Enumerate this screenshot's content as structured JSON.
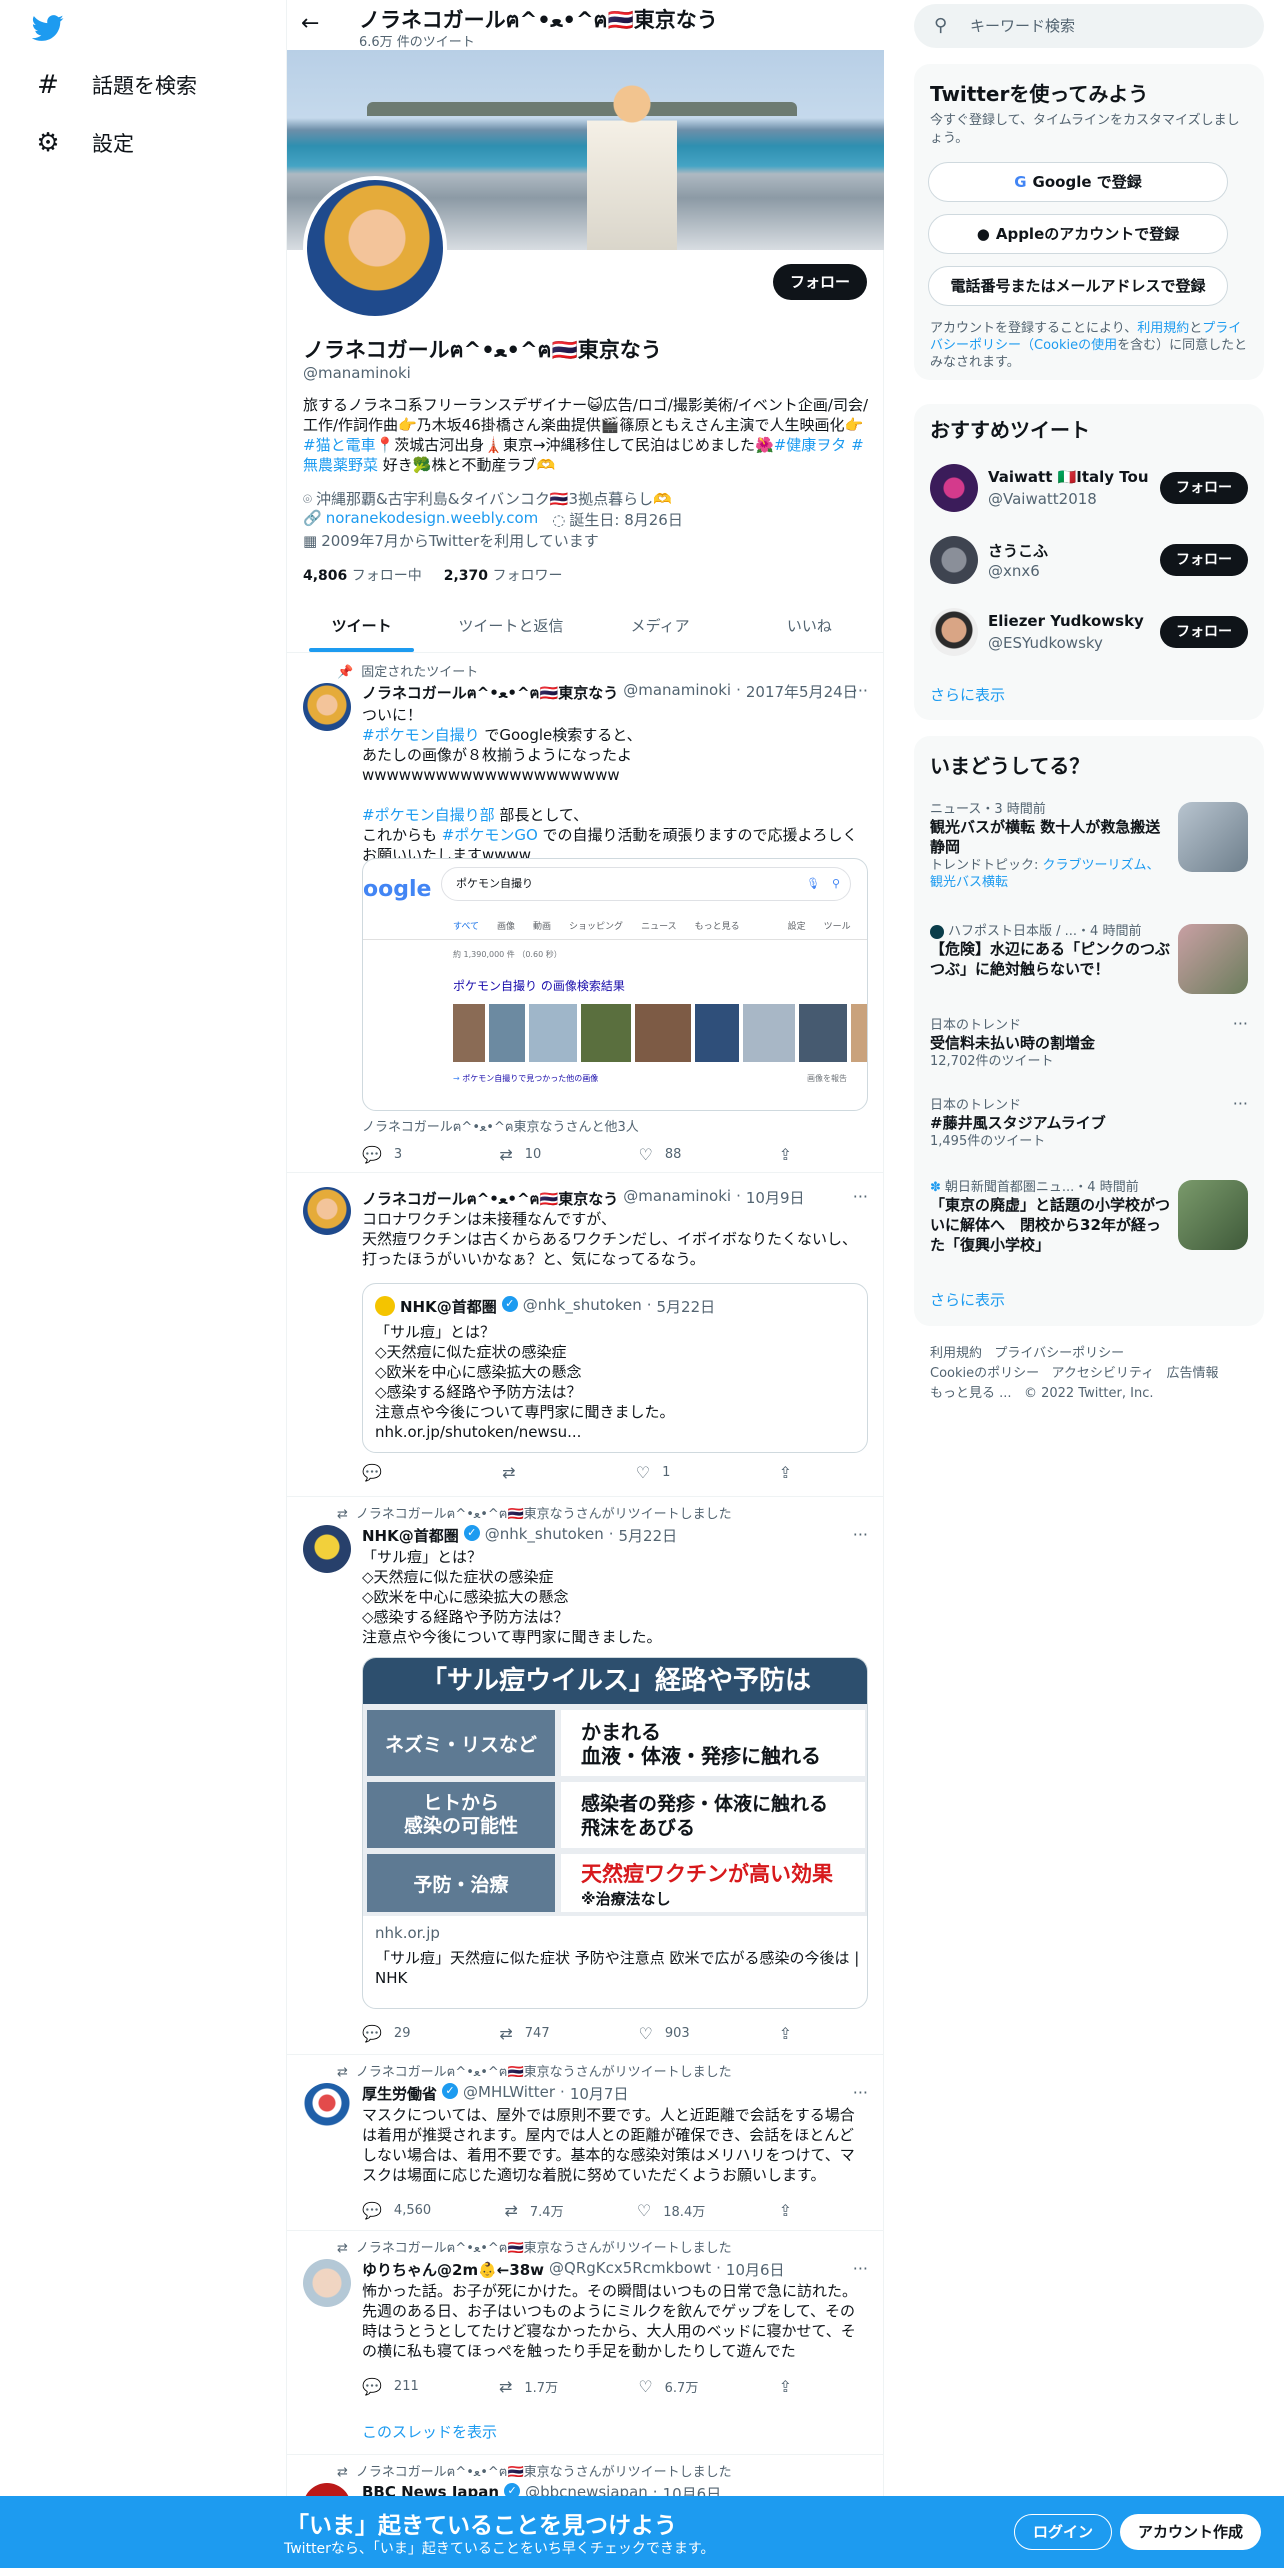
{
  "nav": {
    "explore": "話題を検索",
    "settings": "設定"
  },
  "header": {
    "title": "ノラネコガールฅ^•ﻌ•^ฅ🇹🇭東京なう",
    "tweet_count": "6.6万 件のツイート"
  },
  "profile": {
    "follow": "フォロー",
    "name": "ノラネコガールฅ^•ﻌ•^ฅ🇹🇭東京なう",
    "handle": "@manaminoki",
    "bio_1": "旅するノラネコ系フリーランスデザイナー😺広告/ロゴ/撮影美術/イベント企画/司会/工作/作詞作曲👉乃木坂46掛橋さん楽曲提供🎬篠原ともえさん主演で人生映画化👉",
    "bio_tag1": "#猫と電車",
    "bio_2": "📍茨城古河出身🗼東京→沖縄移住して民泊はじめました🌺",
    "bio_tag2": "#健康ヲタ",
    "bio_tag3": "#無農薬野菜",
    "bio_3": " 好き🥦株と不動産ラブ🫶",
    "location": "沖縄那覇&古宇利島&タイバンコク🇹🇭3拠点暮らし🫶",
    "website": "noranekodesign.weebly.com",
    "birthday": "誕生日: 8月26日",
    "joined": "2009年7月からTwitterを利用しています",
    "following_count": "4,806",
    "following_label": "フォロー中",
    "followers_count": "2,370",
    "followers_label": "フォロワー"
  },
  "tabs": [
    "ツイート",
    "ツイートと返信",
    "メディア",
    "いいね"
  ],
  "tweets": [
    {
      "context": "固定されたツイート",
      "name": "ノラネコガールฅ^•ﻌ•^ฅ🇹🇭東京なう",
      "handle": "@manaminoki",
      "date": "2017年5月24日",
      "text_1": "ついに！",
      "tag_1": "#ポケモン自撮り",
      "text_2": " でGoogle検索すると、\nあたしの画像が８枚揃うようになったよwwwwwwwwwwwwwwwwwwwww",
      "tag_2": "#ポケモン自撮り部",
      "text_3": " 部長として、\nこれからも ",
      "tag_3": "#ポケモンGO",
      "text_4": " での自撮り活動を頑張りますので応援よろしくお願いいたしますwwww",
      "card": {
        "query": "ポケモン自撮り",
        "tabs": [
          "すべて",
          "画像",
          "動画",
          "ショッピング",
          "ニュース",
          "もっと見る",
          "設定",
          "ツール"
        ],
        "result_count": "約 1,390,000 件 （0.60 秒）",
        "result_title": "ポケモン自撮り の画像検索結果",
        "more_images": "ポケモン自撮りで見つかった他の画像",
        "report": "画像を報告"
      },
      "tagged": "ノラネコガールฅ^•ﻌ•^ฅ東京なうさんと他3人",
      "replies": "3",
      "retweets": "10",
      "likes": "88"
    },
    {
      "name": "ノラネコガールฅ^•ﻌ•^ฅ🇹🇭東京なう",
      "handle": "@manaminoki",
      "date": "10月9日",
      "text": "コロナワクチンは未接種なんですが、\n天然痘ワクチンは古くからあるワクチンだし、イボイボなりたくないし、\n打ったほうがいいかなぁ？と、気になってるなう。",
      "quote": {
        "name": "NHK@首都圏",
        "handle": "@nhk_shutoken",
        "date": "5月22日",
        "text": "「サル痘」とは？\n◇天然痘に似た症状の感染症\n◇欧米を中心に感染拡大の懸念\n◇感染する経路や予防方法は？\n注意点や今後について専門家に聞きました。\nnhk.or.jp/shutoken/newsu..."
      },
      "replies": "",
      "retweets": "",
      "likes": "1"
    },
    {
      "context": "ノラネコガールฅ^•ﻌ•^ฅ🇹🇭東京なうさんがリツイートしました",
      "name": "NHK@首都圏",
      "handle": "@nhk_shutoken",
      "date": "5月22日",
      "text": "「サル痘」とは？\n◇天然痘に似た症状の感染症\n◇欧米を中心に感染拡大の懸念\n◇感染する経路や予防方法は？\n注意点や今後について専門家に聞きました。",
      "card": {
        "headline": "「サル痘ウイルス」経路や予防は",
        "row1_label": "ネズミ・リスなど",
        "row1_value": "かまれる\n血液・体液・発疹に触れる",
        "row2_label": "ヒトから\n感染の可能性",
        "row2_value": "感染者の発疹・体液に触れる\n飛沫をあびる",
        "row3_label": "予防・治療",
        "row3_value": "天然痘ワクチンが高い効果",
        "row3_note": "※治療法なし",
        "domain": "nhk.or.jp",
        "title": "「サル痘」天然痘に似た症状 予防や注意点 欧米で広がる感染の今後は | NHK"
      },
      "replies": "29",
      "retweets": "747",
      "likes": "903"
    },
    {
      "context": "ノラネコガールฅ^•ﻌ•^ฅ🇹🇭東京なうさんがリツイートしました",
      "name": "厚生労働省",
      "handle": "@MHLWitter",
      "date": "10月7日",
      "text": "マスクについては、屋外では原則不要です。人と近距離で会話をする場合は着用が推奨されます。屋内では人との距離が確保でき、会話をほとんどしない場合は、着用不要です。基本的な感染対策はメリハリをつけて、マスクは場面に応じた適切な着脱に努めていただくようお願いします。",
      "replies": "4,560",
      "retweets": "7.4万",
      "likes": "18.4万"
    },
    {
      "context": "ノラネコガールฅ^•ﻌ•^ฅ🇹🇭東京なうさんがリツイートしました",
      "name": "ゆりちゃん@2m👶←38w",
      "handle": "@QRgKcx5Rcmkbowt",
      "date": "10月6日",
      "text": "怖かった話。お子が死にかけた。その瞬間はいつもの日常で急に訪れた。\n先週のある日、お子はいつものようにミルクを飲んでゲップをして、その時はうとうとしてたけど寝なかったから、大人用のベッドに寝かせて、その横に私も寝てほっぺを触ったり手足を動かしたりして遊んでた",
      "replies": "211",
      "retweets": "1.7万",
      "likes": "6.7万",
      "thread": "このスレッドを表示"
    },
    {
      "context": "ノラネコガールฅ^•ﻌ•^ฅ🇹🇭東京なうさんがリツイートしました",
      "name": "BBC News Japan",
      "handle": "@bbcnewsjapan",
      "date": "10月6日"
    }
  ],
  "right": {
    "search_placeholder": "キーワード検索",
    "signup_panel": {
      "title": "Twitterを使ってみよう",
      "subtitle": "今すぐ登録して、タイムラインをカスタマイズしましょう。",
      "google": "Google で登録",
      "apple": "Appleのアカウントで登録",
      "email": "電話番号またはメールアドレスで登録",
      "terms_1": "アカウントを登録することにより、",
      "terms_link1": "利用規約",
      "terms_2": "と",
      "terms_link2": "プライバシーポリシー（Cookieの使用",
      "terms_3": "を含む）に同意したとみなされます。"
    },
    "recommend": {
      "title": "おすすめツイート",
      "users": [
        {
          "name": "Vaiwatt 🇮🇹Italy Tour ...",
          "handle": "@Vaiwatt2018",
          "follow": "フォロー"
        },
        {
          "name": "さうこふ",
          "handle": "@xnx6",
          "follow": "フォロー"
        },
        {
          "name": "Eliezer Yudkowsky",
          "handle": "@ESYudkowsky",
          "follow": "フォロー"
        }
      ],
      "more": "さらに表示"
    },
    "trends": {
      "title": "いまどうしてる？",
      "items": [
        {
          "context": "ニュース・3 時間前",
          "title": "観光バスが横転 数十人が救急搬送 静岡",
          "sub_label": "トレンドトピック: ",
          "sub_links": "クラブツーリズム、観光バス横転"
        },
        {
          "context": "ハフポスト日本版 / ...・4 時間前",
          "title": "【危険】水辺にある「ピンクのつぶつぶ」に絶対触らないで！"
        },
        {
          "context": "日本のトレンド",
          "title": "受信料未払い時の割増金",
          "count": "12,702件のツイート"
        },
        {
          "context": "日本のトレンド",
          "title": "#藤井風スタジアムライブ",
          "count": "1,495件のツイート"
        },
        {
          "context": "朝日新聞首都圏ニュ...・4 時間前",
          "title": "「東京の廃虚」と話題の小学校がついに解体へ　閉校から32年が経った「復興小学校」"
        }
      ],
      "more": "さらに表示"
    },
    "footer": [
      "利用規約",
      "プライバシーポリシー",
      "Cookieのポリシー",
      "アクセシビリティ",
      "広告情報",
      "もっと見る ...",
      "© 2022 Twitter, Inc."
    ]
  },
  "bottom": {
    "title": "「いま」起きていることを見つけよう",
    "subtitle": "Twitterなら、「いま」起きていることをいち早くチェックできます。",
    "login": "ログイン",
    "signup": "アカウント作成"
  },
  "colors": {
    "accent": "#1d9bf0",
    "text": "#0f1419",
    "muted": "#536471"
  }
}
